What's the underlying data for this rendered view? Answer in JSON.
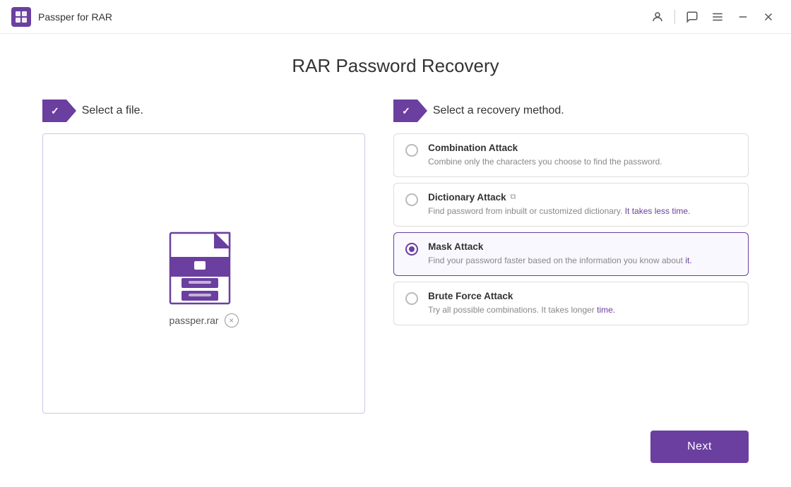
{
  "app": {
    "title": "Passper for RAR"
  },
  "titlebar": {
    "icons": [
      "user-icon",
      "chat-icon",
      "menu-icon",
      "minimize-icon",
      "close-icon"
    ]
  },
  "page": {
    "title": "RAR Password Recovery"
  },
  "left_section": {
    "step_label": "✓",
    "section_title": "Select a file.",
    "file_name": "passper.rar",
    "remove_label": "×"
  },
  "right_section": {
    "step_label": "✓",
    "section_title": "Select a recovery method.",
    "attack_options": [
      {
        "id": "combination",
        "name": "Combination Attack",
        "desc": "Combine only the characters you choose to find the password.",
        "selected": false,
        "has_link": false
      },
      {
        "id": "dictionary",
        "name": "Dictionary Attack",
        "desc": "Find password from inbuilt or customized dictionary. It takes less time.",
        "selected": false,
        "has_link": true
      },
      {
        "id": "mask",
        "name": "Mask Attack",
        "desc": "Find your password faster based on the information you know about it.",
        "selected": true,
        "has_link": false
      },
      {
        "id": "bruteforce",
        "name": "Brute Force Attack",
        "desc": "Try all possible combinations. It takes longer time.",
        "selected": false,
        "has_link": false
      }
    ]
  },
  "bottom": {
    "next_label": "Next"
  }
}
